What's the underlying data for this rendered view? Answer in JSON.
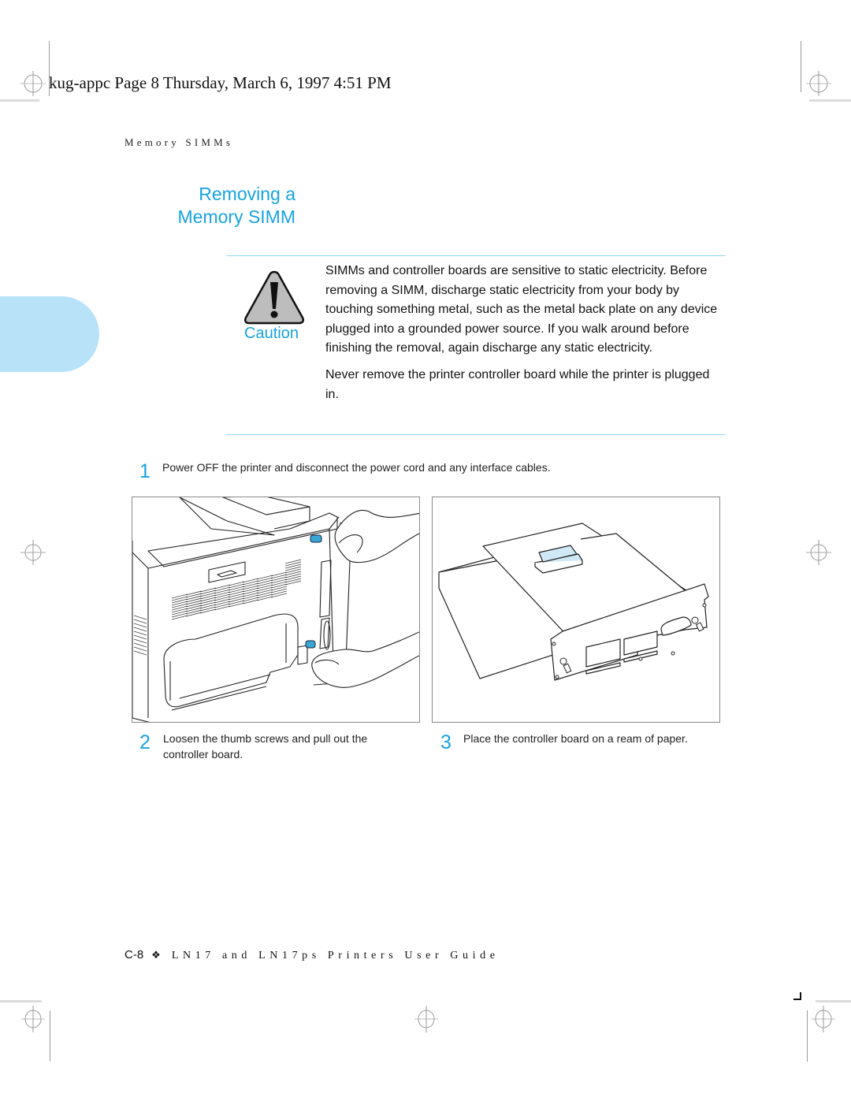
{
  "print_header": {
    "text": "kug-appc  Page 8  Thursday, March 6, 1997  4:51 PM"
  },
  "running_head": {
    "section": "Memory SIMMs"
  },
  "heading": {
    "line1": "Removing a",
    "line2": "Memory SIMM"
  },
  "caution": {
    "icon": "warning-triangle-icon",
    "label": "Caution",
    "paragraphs": [
      "SIMMs and controller boards are sensitive to static electricity. Before removing a SIMM, discharge static electricity from your body by touching something metal, such as the metal back plate on any device plugged into a grounded power source. If you walk around before finishing the removal, again discharge any static electricity.",
      "Never remove the printer controller board while the printer is plugged in."
    ]
  },
  "steps": [
    {
      "number": "1",
      "text": "Power OFF the printer and disconnect the power cord and any interface cables."
    },
    {
      "number": "2",
      "text": "Loosen the thumb screws and pull out the controller board."
    },
    {
      "number": "3",
      "text": "Place the controller board on a ream of paper."
    }
  ],
  "figures": [
    {
      "icon": "printer-rear-hands-illustration",
      "description": "Hands loosening thumb screws on printer controller board"
    },
    {
      "icon": "controller-board-illustration",
      "description": "Controller board placed on ream of paper"
    }
  ],
  "footer": {
    "page": "C-8",
    "separator": "❖",
    "title": "LN17 and LN17ps Printers User Guide"
  },
  "colors": {
    "accent": "#16a3e0",
    "tab": "#b8e2f8",
    "rule": "#8fd6f3",
    "screw": "#3aa6d8",
    "simm": "#cfeaf6"
  }
}
